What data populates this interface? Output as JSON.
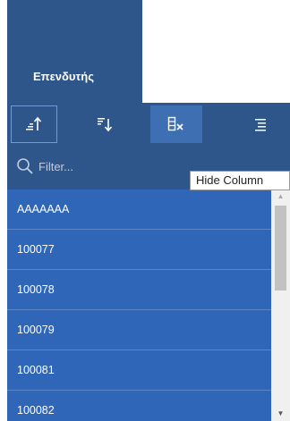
{
  "header": {
    "title": "Επενδυτής"
  },
  "toolbar": {
    "sort_ascending": "sort-ascending-icon",
    "sort_descending": "sort-descending-icon",
    "hide_column": "hide-column-icon",
    "column_menu": "menu-icon"
  },
  "filter": {
    "placeholder": "Filter..."
  },
  "tooltip": {
    "text": "Hide Column"
  },
  "list": {
    "items": [
      "AAAAAAA",
      "100077",
      "100078",
      "100079",
      "100081",
      "100082"
    ]
  },
  "colors": {
    "header_bg": "#2f568b",
    "list_bg": "#2f66b8",
    "selected_tool_bg": "#3f6fb3"
  }
}
